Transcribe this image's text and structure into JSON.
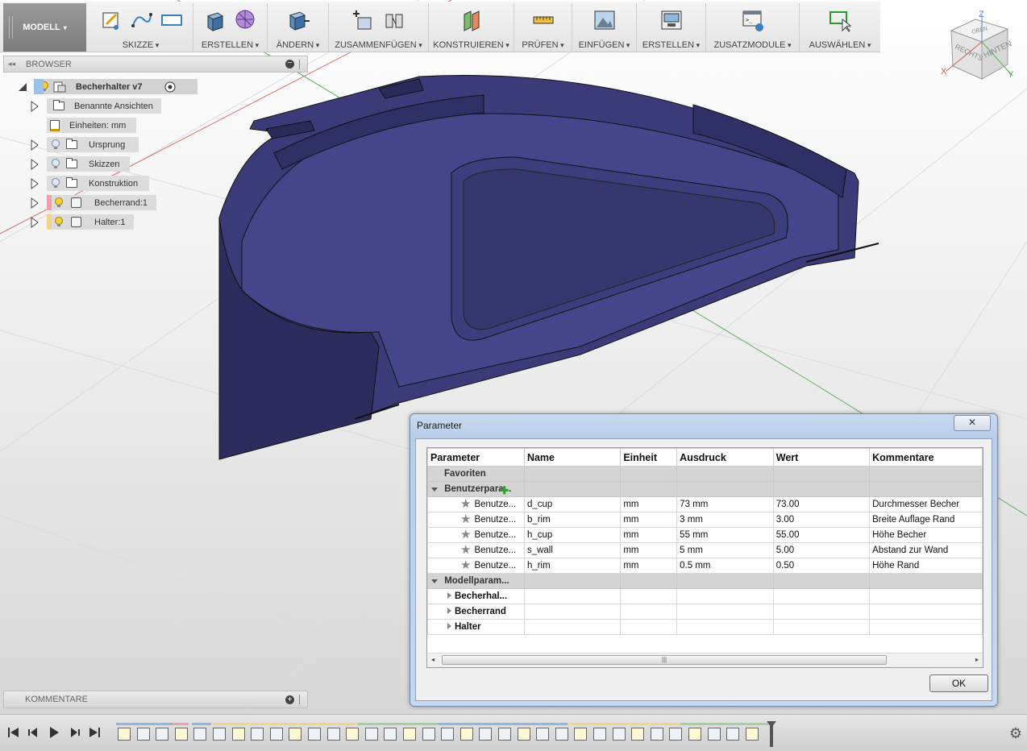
{
  "toolbar": {
    "mode": "MODELL",
    "groups": [
      {
        "label": "SKIZZE"
      },
      {
        "label": "ERSTELLEN"
      },
      {
        "label": "ÄNDERN"
      },
      {
        "label": "ZUSAMMENFÜGEN"
      },
      {
        "label": "KONSTRUIEREN"
      },
      {
        "label": "PRÜFEN"
      },
      {
        "label": "EINFÜGEN"
      },
      {
        "label": "ERSTELLEN"
      },
      {
        "label": "ZUSATZMODULE"
      },
      {
        "label": "AUSWÄHLEN"
      }
    ]
  },
  "viewcube": {
    "top": "OBEN",
    "front": "RECHTS",
    "side": "HINTEN",
    "axis_x": "X",
    "axis_y": "Y",
    "axis_z": "Z"
  },
  "browser": {
    "title": "BROWSER",
    "root": "Becherhalter v7",
    "items": [
      {
        "label": "Benannte Ansichten"
      },
      {
        "label": "Einheiten: mm"
      },
      {
        "label": "Ursprung"
      },
      {
        "label": "Skizzen"
      },
      {
        "label": "Konstruktion"
      },
      {
        "label": "Becherrand:1"
      },
      {
        "label": "Halter:1"
      }
    ]
  },
  "comments": {
    "title": "KOMMENTARE"
  },
  "dialog": {
    "title": "Parameter",
    "close": "✕",
    "ok": "OK",
    "columns": [
      "Parameter",
      "Name",
      "Einheit",
      "Ausdruck",
      "Wert",
      "Kommentare"
    ],
    "favorites": "Favoriten",
    "user_group": "Benutzerpara...",
    "user_params": [
      {
        "param": "Benutze...",
        "name": "d_cup",
        "unit": "mm",
        "expr": "73 mm",
        "value": "73.00",
        "comment": "Durchmesser Becher"
      },
      {
        "param": "Benutze...",
        "name": "b_rim",
        "unit": "mm",
        "expr": "3 mm",
        "value": "3.00",
        "comment": "Breite Auflage Rand"
      },
      {
        "param": "Benutze...",
        "name": "h_cup",
        "unit": "mm",
        "expr": "55 mm",
        "value": "55.00",
        "comment": "Höhe Becher"
      },
      {
        "param": "Benutze...",
        "name": "s_wall",
        "unit": "mm",
        "expr": "5 mm",
        "value": "5.00",
        "comment": "Abstand zur Wand"
      },
      {
        "param": "Benutze...",
        "name": "h_rim",
        "unit": "mm",
        "expr": "0.5 mm",
        "value": "0.50",
        "comment": "Höhe Rand"
      }
    ],
    "model_group": "Modellparam...",
    "model_items": [
      "Becherhal...",
      "Becherrand",
      "Halter"
    ]
  },
  "colors": {
    "model": "#3a3b78",
    "accent": "#5b97d8",
    "grid_red": "#e07070",
    "grid_green": "#60b060"
  }
}
